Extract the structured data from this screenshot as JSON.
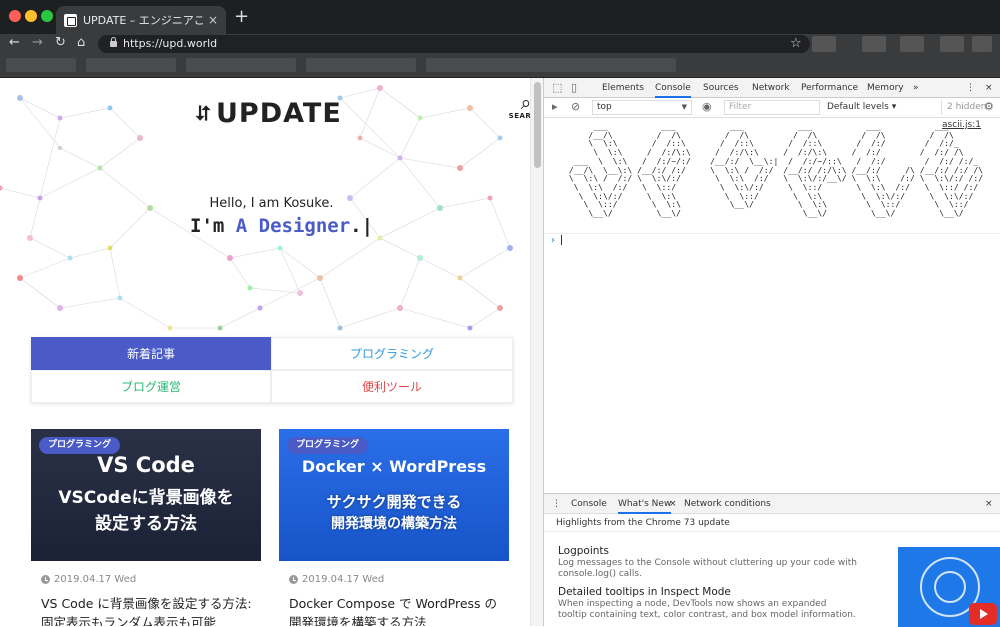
{
  "browser": {
    "tab_title": "UPDATE – エンジニアこうすけの",
    "tab_close": "×",
    "new_tab": "+",
    "url": "https://upd.world",
    "back": "←",
    "forward": "→",
    "reload": "↻",
    "home": "⌂",
    "star": "☆"
  },
  "site": {
    "logo_arrows": "⮃",
    "logo_text": "UPDATE",
    "search_label": "SEARCH",
    "hello": "Hello, I am Kosuke.",
    "designer_prefix": "I'm ",
    "designer_accent": "A Designer",
    "designer_suffix": ".|",
    "categories": [
      "新着記事",
      "プログラミング",
      "ブログ運営",
      "便利ツール"
    ],
    "posts": [
      {
        "badge": "プログラミング",
        "thumb_title": "VS Code",
        "thumb_sub1": "VSCodeに背景画像を",
        "thumb_sub2": "設定する方法",
        "date": "2019.04.17 Wed",
        "title": "VS Code に背景画像を設定する方法: 固定表示もランダム表示も可能"
      },
      {
        "badge": "プログラミング",
        "thumb_title": "Docker × WordPress",
        "thumb_sub1": "サクサク開発できる",
        "thumb_sub2": "開発環境の構築方法",
        "date": "2019.04.17 Wed",
        "title": "Docker Compose で WordPress の開発環境を構築する方法"
      }
    ]
  },
  "devtools": {
    "tabs": [
      "Elements",
      "Console",
      "Sources",
      "Network",
      "Performance",
      "Memory"
    ],
    "more_tabs": "»",
    "context": "top",
    "filter_placeholder": "Filter",
    "levels": "Default levels ▾",
    "hidden": "2 hidden",
    "source_link": "ascii.js:1",
    "ascii_art": "      ___           ___           ___           ___           ___           ___\n     /__/\\         /  /\\         /  /\\         /  /\\         /  /\\         /  /\\\n     \\  \\:\\       /  /::\\       /  /::\\       /  /::\\       /  /:/        /  /:/_\n      \\  \\:\\     /  /:/\\:\\     /  /:/\\:\\     /  /:/\\:\\     /  /:/        /  /:/ /\\\n  ___  \\  \\:\\   /  /:/~/:/    /__/:/  \\__\\:|  /  /:/~/::\\   /  /:/        /  /:/ /:/_\n /__/\\  \\__\\:\\ /__/:/ /:/     \\  \\:\\ /  /:/  /__/:/ /:/\\:\\ /__/:/     /\\ /__/:/ /:/ /\\\n \\  \\:\\ /  /:/ \\  \\:\\/:/       \\  \\:\\  /:/   \\  \\:\\/:/__\\/ \\  \\:\\    /:/ \\  \\:\\/:/ /:/\n  \\  \\:\\  /:/   \\  \\::/         \\  \\:\\/:/     \\  \\::/       \\  \\:\\  /:/   \\  \\::/ /:/\n   \\  \\:\\/:/     \\  \\:\\          \\  \\::/       \\  \\:\\        \\  \\:\\/:/     \\  \\:\\/:/\n    \\  \\::/       \\  \\:\\          \\__\\/         \\  \\:\\        \\  \\::/       \\  \\::/\n     \\__\\/         \\__\\/                         \\__\\/         \\__\\/         \\__\\/",
    "prompt": "›",
    "drawer_tabs": [
      "Console",
      "What's New",
      "Network conditions"
    ],
    "drawer_heading": "Highlights from the Chrome 73 update",
    "features": [
      {
        "title": "Logpoints",
        "desc": "Log messages to the Console without cluttering up your code with console.log() calls."
      },
      {
        "title": "Detailed tooltips in Inspect Mode",
        "desc": "When inspecting a node, DevTools now shows an expanded tooltip containing text, color contrast, and box model information."
      }
    ],
    "close": "×",
    "menu": "⋮"
  },
  "colors": {
    "accent": "#4a5bc8",
    "programming": "#2f9ce0",
    "blog": "#2bb673",
    "tools": "#e0474c",
    "devtools_active": "#1a73e8"
  }
}
